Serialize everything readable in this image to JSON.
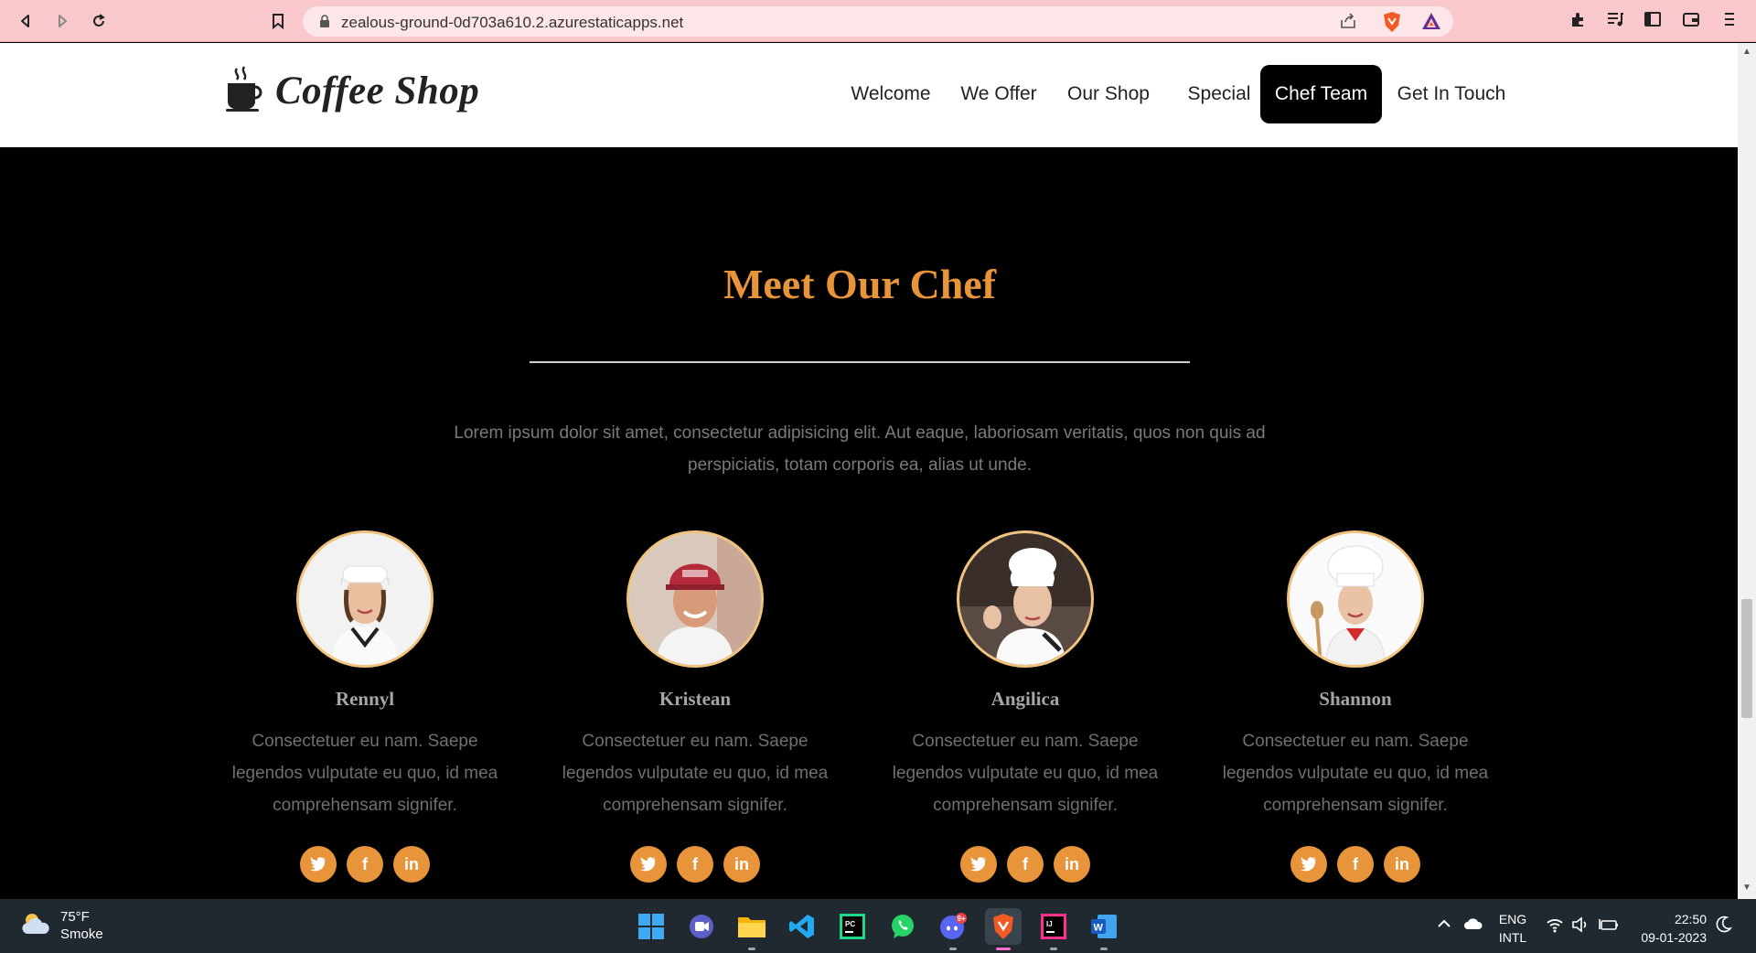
{
  "browser": {
    "url": "zealous-ground-0d703a610.2.azurestaticapps.net"
  },
  "site": {
    "logo_text": "Coffee Shop",
    "nav": [
      {
        "label": "Welcome"
      },
      {
        "label": "We Offer"
      },
      {
        "label": "Our Shop"
      },
      {
        "label": "Special"
      },
      {
        "label": "Chef Team"
      },
      {
        "label": "Get In Touch"
      }
    ],
    "active_nav": "Chef Team"
  },
  "section": {
    "title": "Meet Our Chef",
    "description": "Lorem ipsum dolor sit amet, consectetur adipisicing elit. Aut eaque, laboriosam veritatis, quos non quis ad perspiciatis, totam corporis ea, alias ut unde."
  },
  "chefs": [
    {
      "name": "Rennyl",
      "bio": "Consectetuer eu nam. Saepe legendos vulputate eu quo, id mea comprehensam signifer."
    },
    {
      "name": "Kristean",
      "bio": "Consectetuer eu nam. Saepe legendos vulputate eu quo, id mea comprehensam signifer."
    },
    {
      "name": "Angilica",
      "bio": "Consectetuer eu nam. Saepe legendos vulputate eu quo, id mea comprehensam signifer."
    },
    {
      "name": "Shannon",
      "bio": "Consectetuer eu nam. Saepe legendos vulputate eu quo, id mea comprehensam signifer."
    }
  ],
  "social_icons": [
    "twitter-icon",
    "facebook-icon",
    "linkedin-icon"
  ],
  "colors": {
    "accent": "#e8943a",
    "browser_bar": "#f8c8cc",
    "taskbar": "#202830"
  },
  "taskbar": {
    "weather_temp": "75°F",
    "weather_desc": "Smoke",
    "lang_top": "ENG",
    "lang_bottom": "INTL",
    "time": "22:50",
    "date": "09-01-2023",
    "discord_badge": "9+"
  }
}
